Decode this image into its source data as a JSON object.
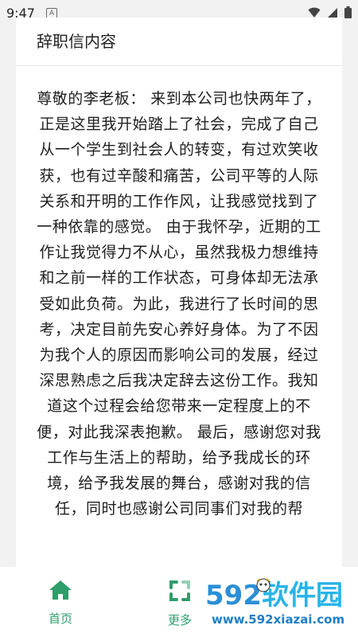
{
  "status_bar": {
    "time": "9:47",
    "a_icon_letter": "A",
    "icons": [
      "notification-a-icon",
      "wifi-icon",
      "cellular-signal-icon",
      "battery-icon"
    ]
  },
  "card": {
    "title": "辞职信内容",
    "body": "尊敬的李老板： 来到本公司也快两年了，正是这里我开始踏上了社会，完成了自己从一个学生到社会人的转变，有过欢笑收获，也有过辛酸和痛苦，公司平等的人际关系和开明的工作作风，让我感觉找到了一种依靠的感觉。 由于我怀孕，近期的工作让我觉得力不从心，虽然我极力想维持和之前一样的工作状态，可身体却无法承受如此负荷。为此，我进行了长时间的思考，决定目前先安心养好身体。为了不因为我个人的原因而影响公司的发展，经过深思熟虑之后我决定辞去这份工作。我知道这个过程会给您带来一定程度上的不便，对此我深表抱歉。 最后，感谢您对我工作与生活上的帮助，给予我成长的环境，给予我发展的舞台，感谢对我的信任，同时也感谢公司同事们对我的帮"
  },
  "bottom_nav": {
    "items": [
      {
        "label": "首页",
        "icon": "home-icon"
      },
      {
        "label": "更多",
        "icon": "more-icon"
      }
    ]
  },
  "watermark": {
    "logo_number": "592",
    "logo_text": "软件园",
    "url": "www.592xiazai.com"
  },
  "colors": {
    "accent": "#2e9e6b",
    "background": "#f2f2f2",
    "card": "#ffffff",
    "watermark": "#2b8fd6"
  }
}
